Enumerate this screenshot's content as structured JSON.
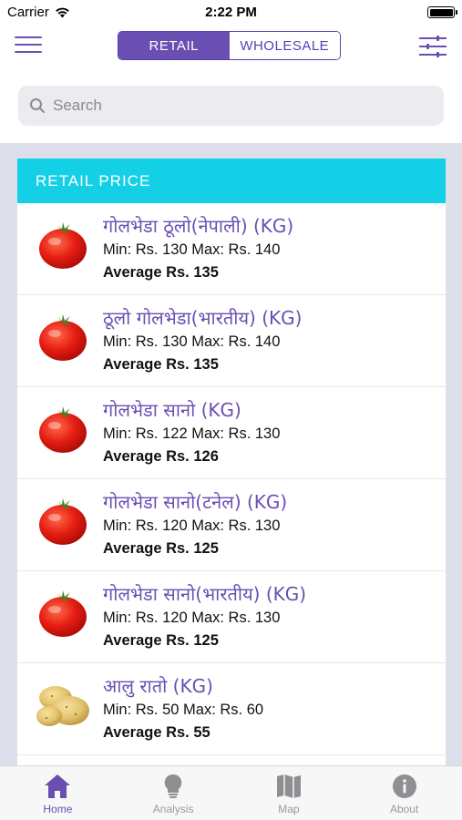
{
  "status_bar": {
    "carrier": "Carrier",
    "time": "2:22 PM"
  },
  "navbar": {
    "segments": [
      {
        "label": "RETAIL",
        "active": true
      },
      {
        "label": "WHOLESALE",
        "active": false
      }
    ]
  },
  "search": {
    "placeholder": "Search",
    "value": ""
  },
  "section": {
    "title": "RETAIL PRICE"
  },
  "items": [
    {
      "name": "गोलभेडा ठूलो(नेपाली)   (KG)",
      "minmax": "Min: Rs. 130   Max: Rs. 140",
      "average": "Average Rs. 135",
      "icon": "tomato"
    },
    {
      "name": "ठूलो गोलभेडा(भारतीय)   (KG)",
      "minmax": "Min: Rs. 130   Max: Rs. 140",
      "average": "Average Rs. 135",
      "icon": "tomato"
    },
    {
      "name": "गोलभेडा सानो   (KG)",
      "minmax": "Min: Rs. 122   Max: Rs. 130",
      "average": "Average Rs. 126",
      "icon": "tomato"
    },
    {
      "name": "गोलभेडा सानो(टनेल)   (KG)",
      "minmax": "Min: Rs. 120   Max: Rs. 130",
      "average": "Average Rs. 125",
      "icon": "tomato"
    },
    {
      "name": "गोलभेडा सानो(भारतीय)   (KG)",
      "minmax": "Min: Rs. 120   Max: Rs. 130",
      "average": "Average Rs. 125",
      "icon": "tomato"
    },
    {
      "name": "आलु रातो   (KG)",
      "minmax": "Min: Rs. 50   Max: Rs. 60",
      "average": "Average Rs. 55",
      "icon": "potato"
    }
  ],
  "tabs": [
    {
      "label": "Home",
      "icon": "home-icon",
      "active": true
    },
    {
      "label": "Analysis",
      "icon": "lightbulb-icon",
      "active": false
    },
    {
      "label": "Map",
      "icon": "map-icon",
      "active": false
    },
    {
      "label": "About",
      "icon": "info-icon",
      "active": false
    }
  ],
  "colors": {
    "accent": "#6a4fb3",
    "header": "#14d0e6",
    "background": "#dde0ea"
  }
}
